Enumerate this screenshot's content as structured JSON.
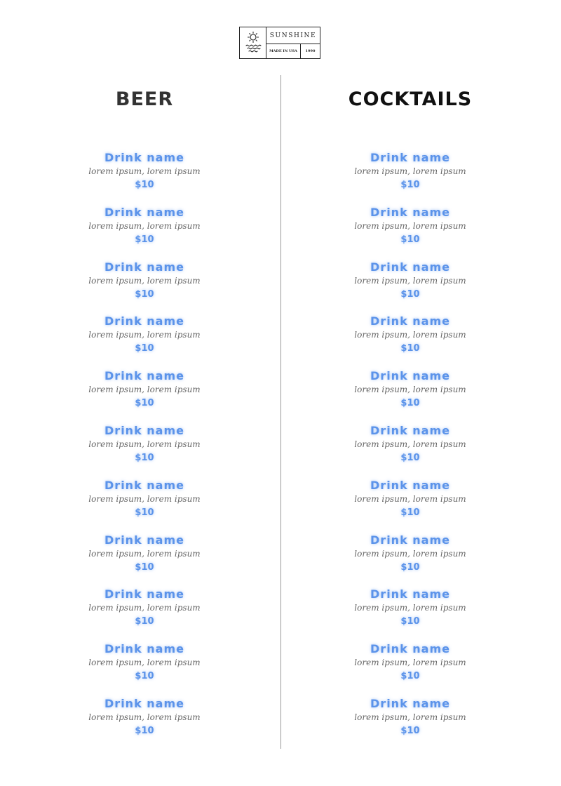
{
  "logo": {
    "brand": "SUNSHINE",
    "origin": "MADE IN USA",
    "year": "1990",
    "icon": "sun-over-waves-icon"
  },
  "colors": {
    "accent": "#5b93ea",
    "heading": "#333333",
    "description": "#666666",
    "divider": "#999999"
  },
  "columns": [
    {
      "heading": "BEER",
      "items": [
        {
          "name": "Drink name",
          "description": "lorem ipsum, lorem ipsum",
          "price": "$10"
        },
        {
          "name": "Drink name",
          "description": "lorem ipsum, lorem ipsum",
          "price": "$10"
        },
        {
          "name": "Drink name",
          "description": "lorem ipsum, lorem ipsum",
          "price": "$10"
        },
        {
          "name": "Drink name",
          "description": "lorem ipsum, lorem ipsum",
          "price": "$10"
        },
        {
          "name": "Drink name",
          "description": "lorem ipsum, lorem ipsum",
          "price": "$10"
        },
        {
          "name": "Drink name",
          "description": "lorem ipsum, lorem ipsum",
          "price": "$10"
        },
        {
          "name": "Drink name",
          "description": "lorem ipsum, lorem ipsum",
          "price": "$10"
        },
        {
          "name": "Drink name",
          "description": "lorem ipsum, lorem ipsum",
          "price": "$10"
        },
        {
          "name": "Drink name",
          "description": "lorem ipsum, lorem ipsum",
          "price": "$10"
        },
        {
          "name": "Drink name",
          "description": "lorem ipsum, lorem ipsum",
          "price": "$10"
        },
        {
          "name": "Drink name",
          "description": "lorem ipsum, lorem ipsum",
          "price": "$10"
        }
      ]
    },
    {
      "heading": "COCKTAILS",
      "items": [
        {
          "name": "Drink name",
          "description": "lorem ipsum, lorem ipsum",
          "price": "$10"
        },
        {
          "name": "Drink name",
          "description": "lorem ipsum, lorem ipsum",
          "price": "$10"
        },
        {
          "name": "Drink name",
          "description": "lorem ipsum, lorem ipsum",
          "price": "$10"
        },
        {
          "name": "Drink name",
          "description": "lorem ipsum, lorem ipsum",
          "price": "$10"
        },
        {
          "name": "Drink name",
          "description": "lorem ipsum, lorem ipsum",
          "price": "$10"
        },
        {
          "name": "Drink name",
          "description": "lorem ipsum, lorem ipsum",
          "price": "$10"
        },
        {
          "name": "Drink name",
          "description": "lorem ipsum, lorem ipsum",
          "price": "$10"
        },
        {
          "name": "Drink name",
          "description": "lorem ipsum, lorem ipsum",
          "price": "$10"
        },
        {
          "name": "Drink name",
          "description": "lorem ipsum, lorem ipsum",
          "price": "$10"
        },
        {
          "name": "Drink name",
          "description": "lorem ipsum, lorem ipsum",
          "price": "$10"
        },
        {
          "name": "Drink name",
          "description": "lorem ipsum, lorem ipsum",
          "price": "$10"
        }
      ]
    }
  ]
}
